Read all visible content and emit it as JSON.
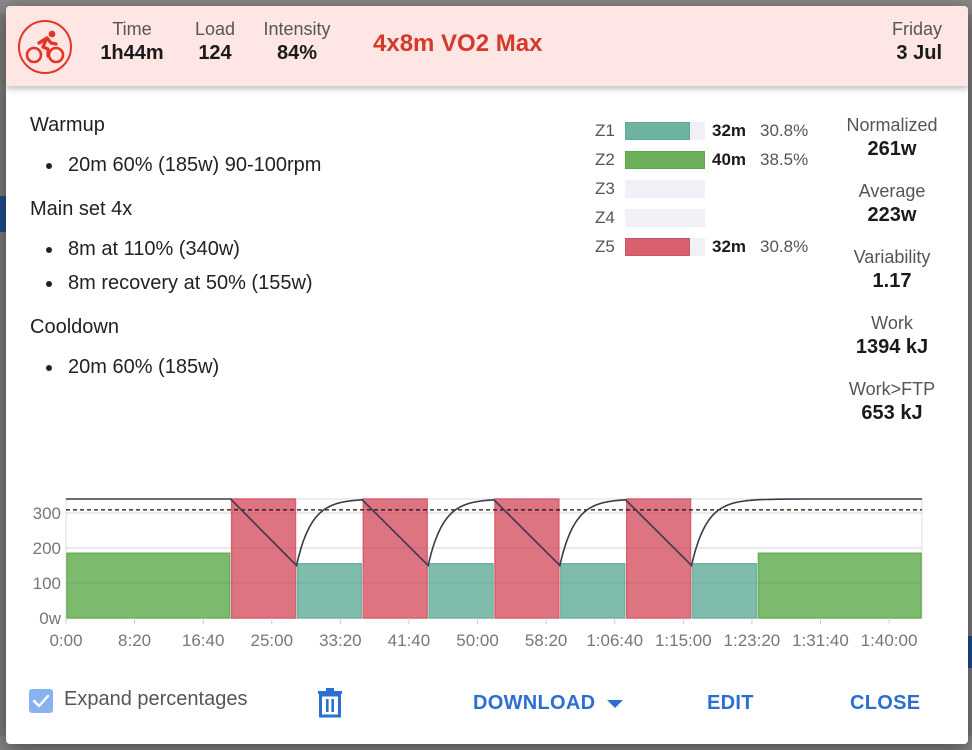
{
  "header": {
    "sport": "cycling",
    "stats": [
      {
        "label": "Time",
        "value": "1h44m"
      },
      {
        "label": "Load",
        "value": "124"
      },
      {
        "label": "Intensity",
        "value": "84%"
      }
    ],
    "title": "4x8m VO2 Max",
    "day": "Friday",
    "date": "3 Jul",
    "background_color": "#fde6e4",
    "accent_color": "#d43a2c"
  },
  "description": {
    "sections": [
      {
        "heading": "Warmup",
        "items": [
          "20m 60% (185w) 90-100rpm"
        ]
      },
      {
        "heading": "Main set 4x",
        "items": [
          "8m at 110% (340w)",
          "8m recovery at 50% (155w)"
        ]
      },
      {
        "heading": "Cooldown",
        "items": [
          "20m 60% (185w)"
        ]
      }
    ]
  },
  "zones": [
    {
      "label": "Z1",
      "time": "32m",
      "percent": "30.8%",
      "fraction": 0.808,
      "color": "#6db3a0"
    },
    {
      "label": "Z2",
      "time": "40m",
      "percent": "38.5%",
      "fraction": 1.0,
      "color": "#6ab05a"
    },
    {
      "label": "Z3",
      "time": "",
      "percent": "",
      "fraction": 0,
      "color": "#f0f0f6"
    },
    {
      "label": "Z4",
      "time": "",
      "percent": "",
      "fraction": 0,
      "color": "#f0f0f6"
    },
    {
      "label": "Z5",
      "time": "32m",
      "percent": "30.8%",
      "fraction": 0.808,
      "color": "#d9606f"
    }
  ],
  "metrics": [
    {
      "label": "Normalized",
      "value": "261w"
    },
    {
      "label": "Average",
      "value": "223w"
    },
    {
      "label": "Variability",
      "value": "1.17"
    },
    {
      "label": "Work",
      "value": "1394 kJ"
    },
    {
      "label": "Work>FTP",
      "value": "653 kJ"
    }
  ],
  "chart_data": {
    "type": "bar",
    "title": "",
    "xlabel": "",
    "ylabel": "",
    "x_unit": "seconds",
    "xlim": [
      0,
      6240
    ],
    "ylim": [
      0,
      340
    ],
    "x_ticks": [
      {
        "value": 0,
        "label": "0:00"
      },
      {
        "value": 500,
        "label": "8:20"
      },
      {
        "value": 1000,
        "label": "16:40"
      },
      {
        "value": 1500,
        "label": "25:00"
      },
      {
        "value": 2000,
        "label": "33:20"
      },
      {
        "value": 2500,
        "label": "41:40"
      },
      {
        "value": 3000,
        "label": "50:00"
      },
      {
        "value": 3500,
        "label": "58:20"
      },
      {
        "value": 4000,
        "label": "1:06:40"
      },
      {
        "value": 4500,
        "label": "1:15:00"
      },
      {
        "value": 5000,
        "label": "1:23:20"
      },
      {
        "value": 5500,
        "label": "1:31:40"
      },
      {
        "value": 6000,
        "label": "1:40:00"
      }
    ],
    "y_ticks": [
      {
        "value": 0,
        "label": "0w"
      },
      {
        "value": 100,
        "label": "100"
      },
      {
        "value": 200,
        "label": "200"
      },
      {
        "value": 300,
        "label": "300"
      }
    ],
    "grid": true,
    "ftp_line_watts": 309,
    "segments": [
      {
        "start": 0,
        "duration": 1200,
        "watts": 185,
        "zone": "Z2"
      },
      {
        "start": 1200,
        "duration": 480,
        "watts": 340,
        "zone": "Z5"
      },
      {
        "start": 1680,
        "duration": 480,
        "watts": 155,
        "zone": "Z1"
      },
      {
        "start": 2160,
        "duration": 480,
        "watts": 340,
        "zone": "Z5"
      },
      {
        "start": 2640,
        "duration": 480,
        "watts": 155,
        "zone": "Z1"
      },
      {
        "start": 3120,
        "duration": 480,
        "watts": 340,
        "zone": "Z5"
      },
      {
        "start": 3600,
        "duration": 480,
        "watts": 155,
        "zone": "Z1"
      },
      {
        "start": 4080,
        "duration": 480,
        "watts": 340,
        "zone": "Z5"
      },
      {
        "start": 4560,
        "duration": 480,
        "watts": 155,
        "zone": "Z1"
      },
      {
        "start": 5040,
        "duration": 1200,
        "watts": 185,
        "zone": "Z2"
      }
    ],
    "zone_colors": {
      "Z1": "#6db3a0",
      "Z2": "#6ab05a",
      "Z5": "#d9606f"
    },
    "balance_series": {
      "name": "W' balance (scaled)",
      "max_watts_equiv": 340,
      "min_watts_equiv": 150
    }
  },
  "footer": {
    "checkbox_label": "Expand percentages",
    "checkbox_checked": true,
    "download_label": "DOWNLOAD",
    "edit_label": "EDIT",
    "close_label": "CLOSE",
    "button_color": "#2a6fd1"
  }
}
